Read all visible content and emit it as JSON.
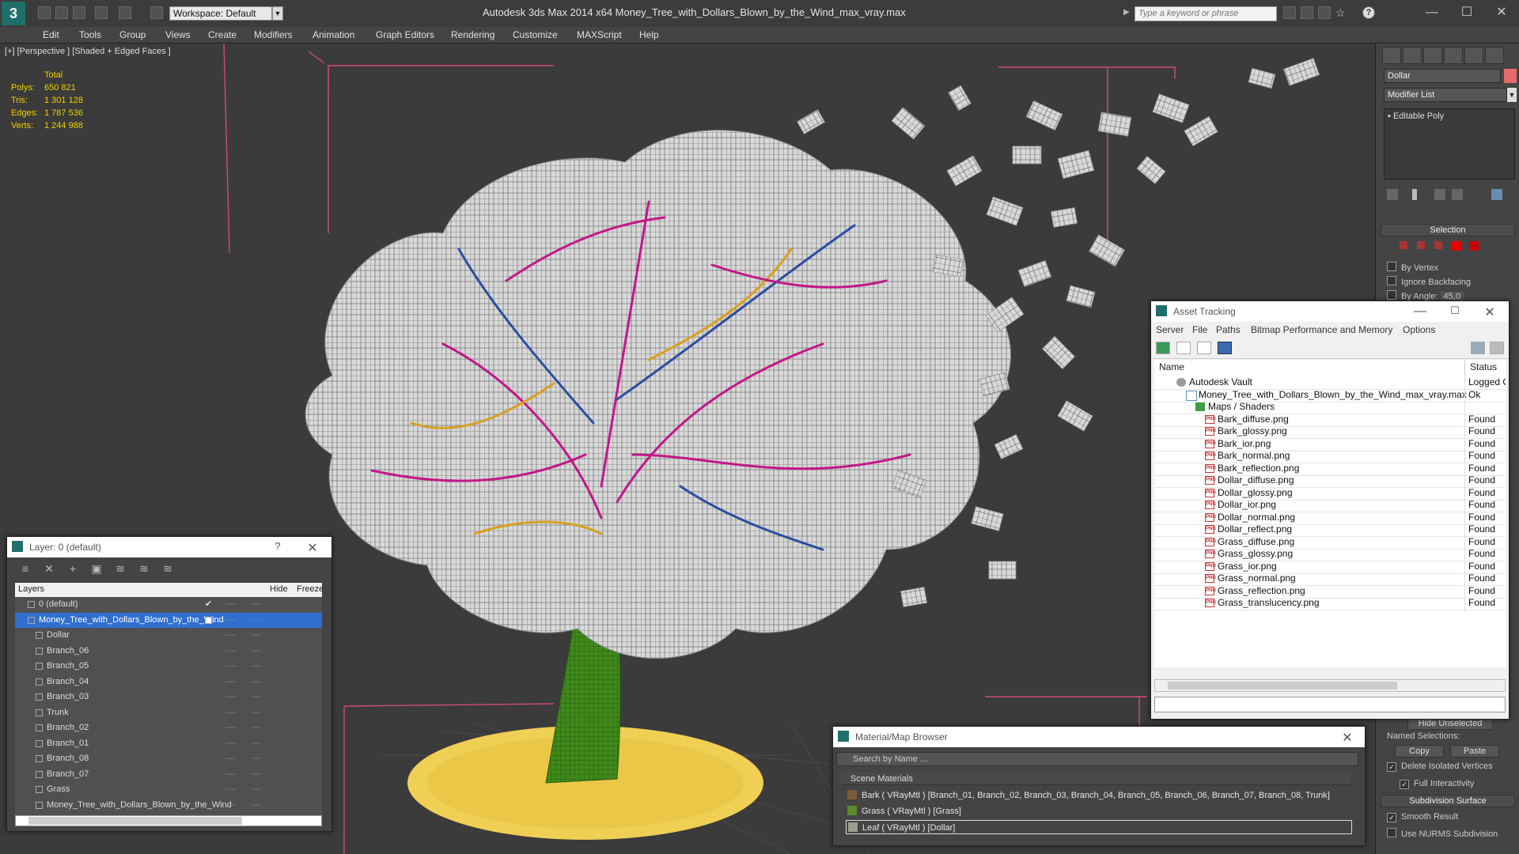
{
  "app": {
    "title": "Autodesk 3ds Max  2014 x64     Money_Tree_with_Dollars_Blown_by_the_Wind_max_vray.max",
    "workspace": "Workspace: Default",
    "search_placeholder": "Type a keyword or phrase",
    "logo": "3"
  },
  "menu": [
    "Edit",
    "Tools",
    "Group",
    "Views",
    "Create",
    "Modifiers",
    "Animation",
    "Graph Editors",
    "Rendering",
    "Customize",
    "MAXScript",
    "Help"
  ],
  "viewport": {
    "label": "[+] [Perspective ] [Shaded + Edged Faces ]",
    "stats": {
      "total_label": "Total",
      "rows": [
        {
          "label": "Polys:",
          "value": "650 821"
        },
        {
          "label": "Tris:",
          "value": "1 301 128"
        },
        {
          "label": "Edges:",
          "value": "1 787 536"
        },
        {
          "label": "Verts:",
          "value": "1 244 988"
        }
      ]
    }
  },
  "command_panel": {
    "object_name": "Dollar",
    "object_color": "#e86a6a",
    "modifier_list": "Modifier List",
    "stack_item": "Editable Poly",
    "selection_title": "Selection",
    "by_vertex": "By Vertex",
    "ignore_backfacing": "Ignore Backfacing",
    "by_angle": "By Angle:",
    "angle_value": "45,0",
    "hide_unselected": "Hide Unselected",
    "named_selections": "Named Selections:",
    "copy": "Copy",
    "paste": "Paste",
    "delete_isolated": "Delete Isolated Vertices",
    "full_interactivity": "Full Interactivity",
    "subdivision_title": "Subdivision Surface",
    "smooth_result": "Smooth Result",
    "use_nurms": "Use NURMS Subdivision"
  },
  "layer_window": {
    "title": "Layer: 0 (default)",
    "help": "?",
    "columns": {
      "layers": "Layers",
      "hide": "Hide",
      "freeze": "Freeze"
    },
    "rows": [
      {
        "name": "0 (default)",
        "indent": 1,
        "check": true
      },
      {
        "name": "Money_Tree_with_Dollars_Blown_by_the_Wind",
        "indent": 1,
        "selected": true
      },
      {
        "name": "Dollar",
        "indent": 2
      },
      {
        "name": "Branch_06",
        "indent": 2
      },
      {
        "name": "Branch_05",
        "indent": 2
      },
      {
        "name": "Branch_04",
        "indent": 2
      },
      {
        "name": "Branch_03",
        "indent": 2
      },
      {
        "name": "Trunk",
        "indent": 2
      },
      {
        "name": "Branch_02",
        "indent": 2
      },
      {
        "name": "Branch_01",
        "indent": 2
      },
      {
        "name": "Branch_08",
        "indent": 2
      },
      {
        "name": "Branch_07",
        "indent": 2
      },
      {
        "name": "Grass",
        "indent": 2
      },
      {
        "name": "Money_Tree_with_Dollars_Blown_by_the_Wind",
        "indent": 2
      }
    ]
  },
  "asset_window": {
    "title": "Asset Tracking",
    "menu": [
      "Server",
      "File",
      "Paths",
      "Bitmap Performance and Memory",
      "Options"
    ],
    "columns": {
      "name": "Name",
      "status": "Status"
    },
    "rows": [
      {
        "name": "Autodesk Vault",
        "status": "Logged Out",
        "level": 1,
        "icon": "vault"
      },
      {
        "name": "Money_Tree_with_Dollars_Blown_by_the_Wind_max_vray.max",
        "status": "Ok",
        "level": 2,
        "icon": "max"
      },
      {
        "name": "Maps / Shaders",
        "status": "",
        "level": 3,
        "icon": "folder"
      },
      {
        "name": "Bark_diffuse.png",
        "status": "Found",
        "level": 4,
        "icon": "png"
      },
      {
        "name": "Bark_glossy.png",
        "status": "Found",
        "level": 4,
        "icon": "png"
      },
      {
        "name": "Bark_ior.png",
        "status": "Found",
        "level": 4,
        "icon": "png"
      },
      {
        "name": "Bark_normal.png",
        "status": "Found",
        "level": 4,
        "icon": "png"
      },
      {
        "name": "Bark_reflection.png",
        "status": "Found",
        "level": 4,
        "icon": "png"
      },
      {
        "name": "Dollar_diffuse.png",
        "status": "Found",
        "level": 4,
        "icon": "png"
      },
      {
        "name": "Dollar_glossy.png",
        "status": "Found",
        "level": 4,
        "icon": "png"
      },
      {
        "name": "Dollar_ior.png",
        "status": "Found",
        "level": 4,
        "icon": "png"
      },
      {
        "name": "Dollar_normal.png",
        "status": "Found",
        "level": 4,
        "icon": "png"
      },
      {
        "name": "Dollar_reflect.png",
        "status": "Found",
        "level": 4,
        "icon": "png"
      },
      {
        "name": "Grass_diffuse.png",
        "status": "Found",
        "level": 4,
        "icon": "png"
      },
      {
        "name": "Grass_glossy.png",
        "status": "Found",
        "level": 4,
        "icon": "png"
      },
      {
        "name": "Grass_ior.png",
        "status": "Found",
        "level": 4,
        "icon": "png"
      },
      {
        "name": "Grass_normal.png",
        "status": "Found",
        "level": 4,
        "icon": "png"
      },
      {
        "name": "Grass_reflection.png",
        "status": "Found",
        "level": 4,
        "icon": "png"
      },
      {
        "name": "Grass_translucency.png",
        "status": "Found",
        "level": 4,
        "icon": "png"
      }
    ]
  },
  "material_window": {
    "title": "Material/Map Browser",
    "search_placeholder": "Search by Name ...",
    "group": "Scene Materials",
    "rows": [
      {
        "text": "Bark  ( VRayMtl )  [Branch_01, Branch_02, Branch_03, Branch_04, Branch_05, Branch_06, Branch_07, Branch_08, Trunk]",
        "swatch": "#7a5a3a"
      },
      {
        "text": "Grass  ( VRayMtl )  [Grass]",
        "swatch": "#5a8a2a"
      },
      {
        "text": "Leaf  ( VRayMtl )  [Dollar]",
        "swatch": "#9aa08a"
      }
    ]
  }
}
